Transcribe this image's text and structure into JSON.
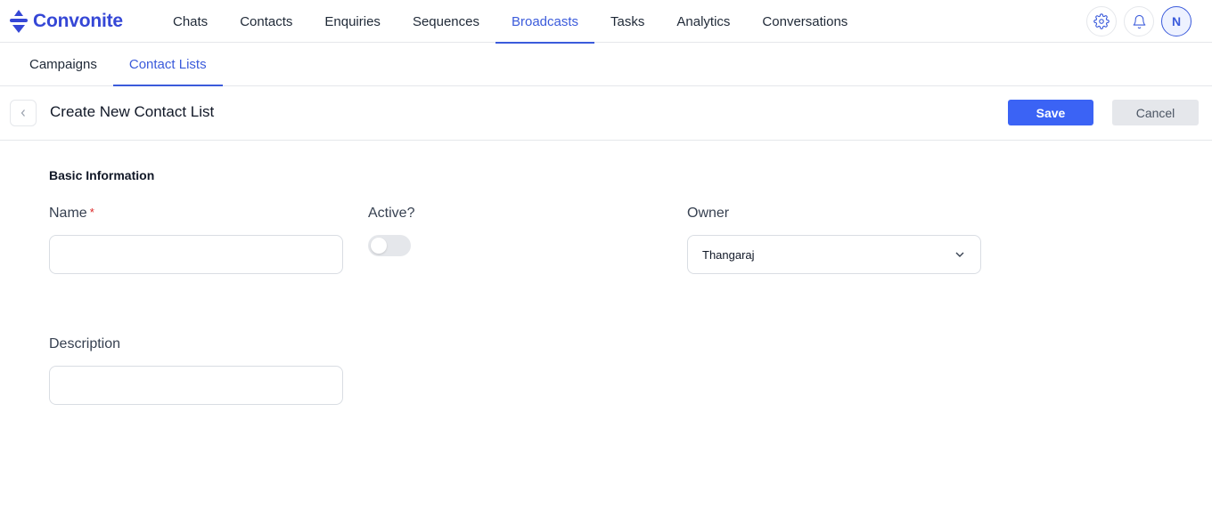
{
  "brand": {
    "name": "Convonite",
    "accent": "#3b5bdb",
    "logo_color": "#3547d6"
  },
  "nav": {
    "items": [
      {
        "label": "Chats",
        "active": false
      },
      {
        "label": "Contacts",
        "active": false
      },
      {
        "label": "Enquiries",
        "active": false
      },
      {
        "label": "Sequences",
        "active": false
      },
      {
        "label": "Broadcasts",
        "active": true
      },
      {
        "label": "Tasks",
        "active": false
      },
      {
        "label": "Analytics",
        "active": false
      },
      {
        "label": "Conversations",
        "active": false
      }
    ],
    "settings_icon": "gear-icon",
    "notifications_icon": "bell-icon",
    "avatar_initial": "N"
  },
  "subtabs": [
    {
      "label": "Campaigns",
      "active": false
    },
    {
      "label": "Contact Lists",
      "active": true
    }
  ],
  "header": {
    "back_icon": "chevron-left-icon",
    "title": "Create New Contact List",
    "save_label": "Save",
    "cancel_label": "Cancel",
    "save_color": "#3b63f5"
  },
  "form": {
    "section_title": "Basic Information",
    "name": {
      "label": "Name",
      "required_mark": "*",
      "value": ""
    },
    "active": {
      "label": "Active?",
      "on": false
    },
    "owner": {
      "label": "Owner",
      "value": "Thangaraj",
      "icon": "chevron-down-icon"
    },
    "description": {
      "label": "Description",
      "value": ""
    }
  }
}
